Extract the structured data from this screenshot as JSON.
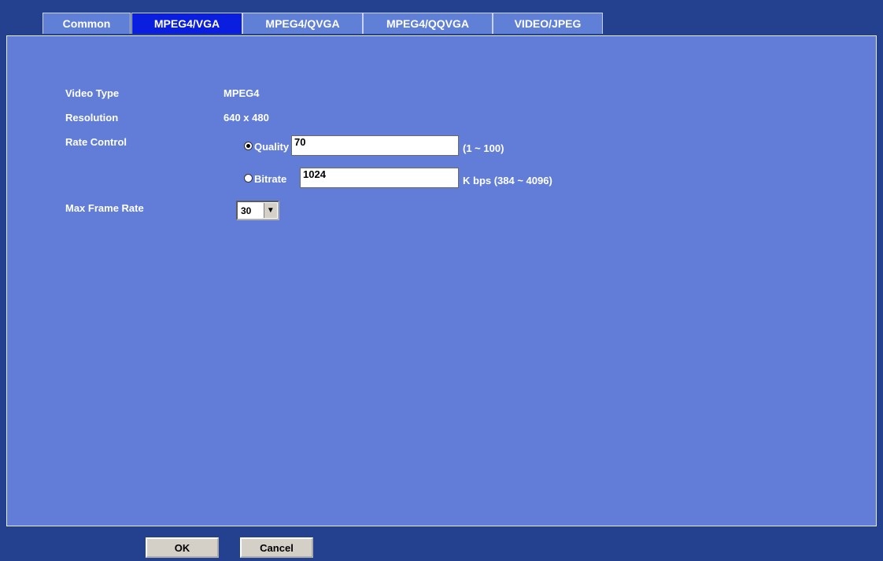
{
  "tabs": [
    {
      "label": "Common",
      "active": false
    },
    {
      "label": "MPEG4/VGA",
      "active": true
    },
    {
      "label": "MPEG4/QVGA",
      "active": false
    },
    {
      "label": "MPEG4/QQVGA",
      "active": false
    },
    {
      "label": "VIDEO/JPEG",
      "active": false
    }
  ],
  "form": {
    "video_type": {
      "label": "Video Type",
      "value": "MPEG4"
    },
    "resolution": {
      "label": "Resolution",
      "value": "640 x 480"
    },
    "rate_control": {
      "label": "Rate Control",
      "quality": {
        "label": "Quality",
        "value": "70",
        "hint": "(1 ~ 100)",
        "selected": true
      },
      "bitrate": {
        "label": "Bitrate",
        "value": "1024",
        "hint": "K bps (384 ~ 4096)",
        "selected": false
      }
    },
    "max_frame_rate": {
      "label": "Max Frame Rate",
      "value": "30"
    }
  },
  "buttons": {
    "ok": "OK",
    "cancel": "Cancel"
  },
  "colors": {
    "frame": "#23418f",
    "panel": "#617dd8",
    "tab": "#6080d8",
    "tab_active": "#0a1ee0"
  },
  "icons": {
    "select_arrow": "chevron-down-icon"
  }
}
